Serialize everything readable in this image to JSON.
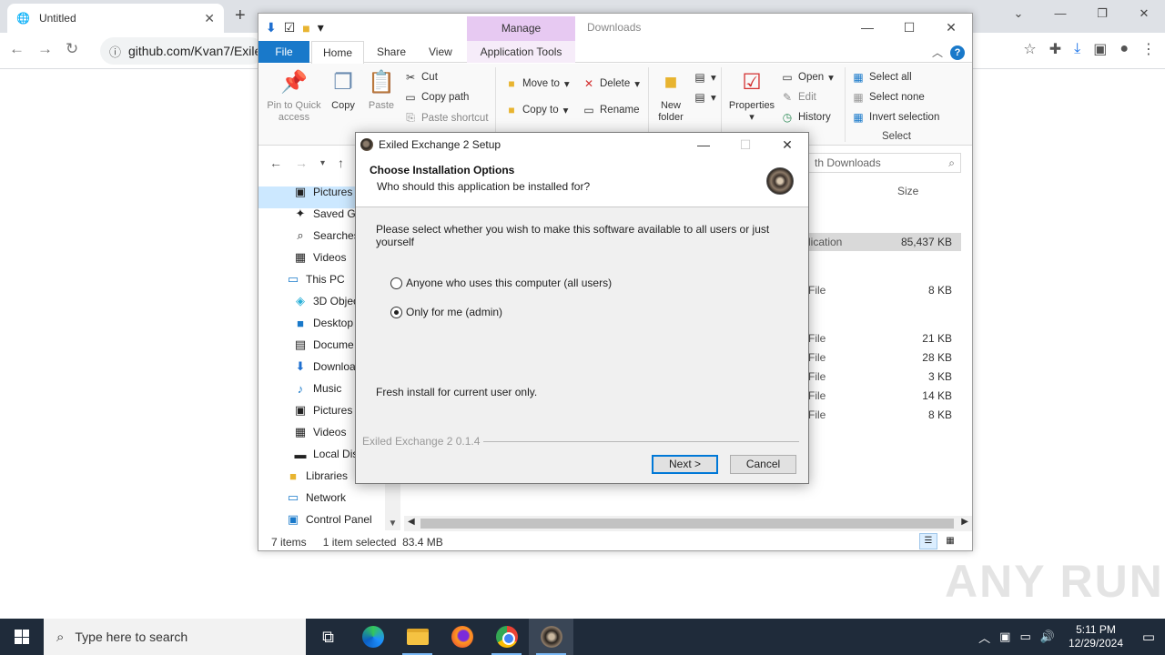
{
  "browser": {
    "tab_title": "Untitled",
    "url": "github.com/Kvan7/Exile"
  },
  "explorer": {
    "title": "Downloads",
    "manage_label": "Manage",
    "tabs": [
      "File",
      "Home",
      "Share",
      "View",
      "Application Tools"
    ],
    "ribbon": {
      "pin_quick_access": "Pin to Quick access",
      "copy": "Copy",
      "paste": "Paste",
      "cut": "Cut",
      "copy_path": "Copy path",
      "paste_shortcut": "Paste shortcut",
      "move_to": "Move to",
      "copy_to": "Copy to",
      "delete": "Delete",
      "rename": "Rename",
      "new_folder": "New folder",
      "properties": "Properties",
      "open": "Open",
      "edit": "Edit",
      "history": "History",
      "select_all": "Select all",
      "select_none": "Select none",
      "invert_selection": "Invert selection",
      "select_group": "Select"
    },
    "search_placeholder": "th Downloads",
    "nav_items": [
      {
        "label": "Pictures",
        "icon": "pictures-icon"
      },
      {
        "label": "Saved Ga",
        "icon": "saved-games-icon"
      },
      {
        "label": "Searches",
        "icon": "searches-icon"
      },
      {
        "label": "Videos",
        "icon": "videos-icon"
      },
      {
        "label": "This PC",
        "icon": "this-pc-icon"
      },
      {
        "label": "3D Objec",
        "icon": "3d-objects-icon"
      },
      {
        "label": "Desktop",
        "icon": "desktop-icon"
      },
      {
        "label": "Docume",
        "icon": "documents-icon"
      },
      {
        "label": "Downloa",
        "icon": "downloads-icon"
      },
      {
        "label": "Music",
        "icon": "music-icon"
      },
      {
        "label": "Pictures",
        "icon": "pictures-icon"
      },
      {
        "label": "Videos",
        "icon": "videos-icon"
      },
      {
        "label": "Local Dis",
        "icon": "local-disk-icon"
      },
      {
        "label": "Libraries",
        "icon": "libraries-icon"
      },
      {
        "label": "Network",
        "icon": "network-icon"
      },
      {
        "label": "Control Panel",
        "icon": "control-panel-icon"
      }
    ],
    "column_size": "Size",
    "rows": [
      {
        "type": "lication",
        "size": "85,437 KB"
      },
      {
        "type": "File",
        "size": "8 KB"
      },
      {
        "type": "File",
        "size": "21 KB"
      },
      {
        "type": "File",
        "size": "28 KB"
      },
      {
        "type": "File",
        "size": "3 KB"
      },
      {
        "type": "File",
        "size": "14 KB"
      },
      {
        "type": "File",
        "size": "8 KB"
      }
    ],
    "status": {
      "items": "7 items",
      "selected": "1 item selected",
      "size": "83.4 MB"
    }
  },
  "setup": {
    "title": "Exiled Exchange 2 Setup",
    "heading": "Choose Installation Options",
    "subheading": "Who should this application be installed for?",
    "description": "Please select whether you wish to make this software available to all users or just yourself",
    "option_all": "Anyone who uses this computer (all users)",
    "option_me": "Only for me (admin)",
    "note": "Fresh install for current user only.",
    "brand": "Exiled Exchange 2 0.1.4",
    "next": "Next >",
    "cancel": "Cancel"
  },
  "watermark": "ANY RUN",
  "taskbar": {
    "search_placeholder": "Type here to search",
    "time": "5:11 PM",
    "date": "12/29/2024"
  }
}
